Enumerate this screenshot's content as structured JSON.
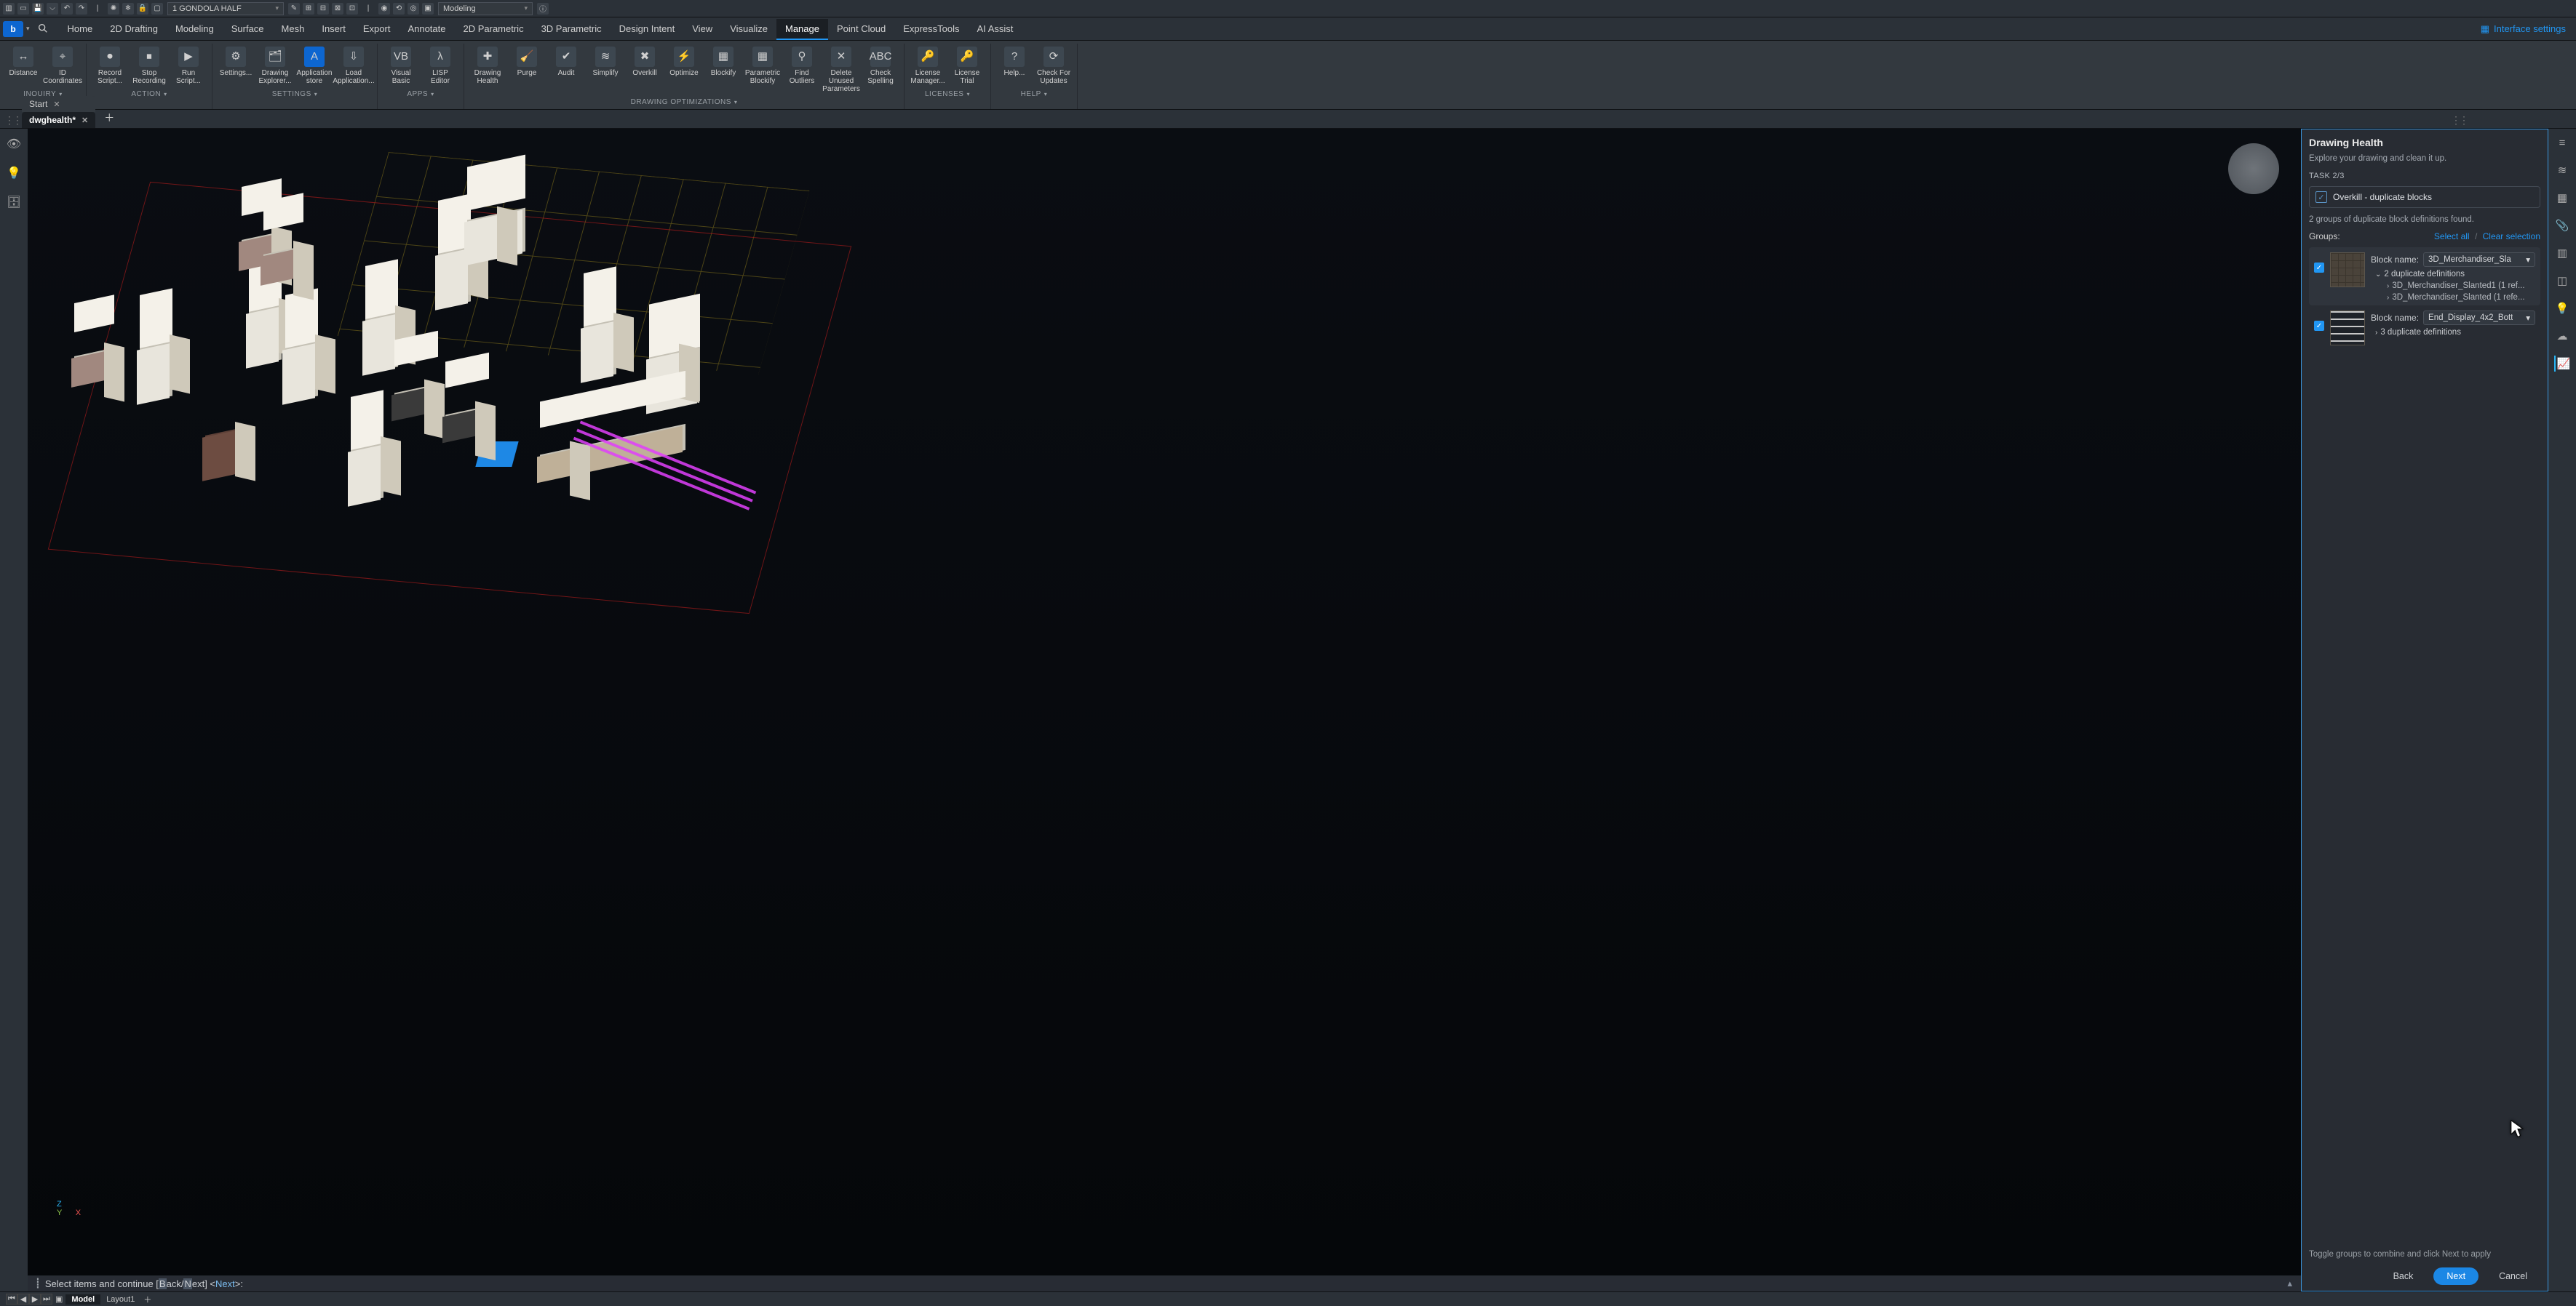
{
  "titlebar": {
    "layer_dropdown": "1 GONDOLA HALF",
    "workspace_dropdown": "Modeling"
  },
  "menubar": {
    "items": [
      "Home",
      "2D Drafting",
      "Modeling",
      "Surface",
      "Mesh",
      "Insert",
      "Export",
      "Annotate",
      "2D Parametric",
      "3D Parametric",
      "Design Intent",
      "View",
      "Visualize",
      "Manage",
      "Point Cloud",
      "ExpressTools",
      "AI Assist"
    ],
    "active": "Manage",
    "interface_link": "Interface settings"
  },
  "ribbon": {
    "panels": [
      {
        "label": "INQUIRY",
        "tools": [
          {
            "label": "Distance",
            "icon": "↔"
          },
          {
            "label": "ID Coordinates",
            "icon": "⌖"
          }
        ]
      },
      {
        "label": "ACTION",
        "tools": [
          {
            "label": "Record Script...",
            "icon": "⏺"
          },
          {
            "label": "Stop Recording",
            "icon": "⏹"
          },
          {
            "label": "Run Script...",
            "icon": "▶"
          }
        ]
      },
      {
        "label": "SETTINGS",
        "tools": [
          {
            "label": "Settings...",
            "icon": "⚙"
          },
          {
            "label": "Drawing Explorer...",
            "icon": "🗂"
          },
          {
            "label": "Application store",
            "icon": "A",
            "highlight": true
          },
          {
            "label": "Load Application...",
            "icon": "⇩"
          }
        ]
      },
      {
        "label": "APPS",
        "tools": [
          {
            "label": "Visual Basic",
            "icon": "VB"
          },
          {
            "label": "LISP Editor",
            "icon": "λ"
          }
        ]
      },
      {
        "label": "DRAWING OPTIMIZATIONS",
        "tools": [
          {
            "label": "Drawing Health",
            "icon": "✚"
          },
          {
            "label": "Purge",
            "icon": "🧹"
          },
          {
            "label": "Audit",
            "icon": "✔"
          },
          {
            "label": "Simplify",
            "icon": "≋"
          },
          {
            "label": "Overkill",
            "icon": "✖"
          },
          {
            "label": "Optimize",
            "icon": "⚡"
          },
          {
            "label": "Blockify",
            "icon": "▦"
          },
          {
            "label": "Parametric Blockify",
            "icon": "▦"
          },
          {
            "label": "Find Outliers",
            "icon": "⚲"
          },
          {
            "label": "Delete Unused Parameters",
            "icon": "✕"
          },
          {
            "label": "Check Spelling",
            "icon": "ABC"
          }
        ]
      },
      {
        "label": "LICENSES",
        "tools": [
          {
            "label": "License Manager...",
            "icon": "🔑"
          },
          {
            "label": "License Trial",
            "icon": "🔑"
          }
        ]
      },
      {
        "label": "HELP",
        "tools": [
          {
            "label": "Help...",
            "icon": "?"
          },
          {
            "label": "Check For Updates",
            "icon": "⟳"
          }
        ]
      }
    ]
  },
  "doctabs": {
    "tabs": [
      {
        "label": "Start",
        "active": false
      },
      {
        "label": "dwghealth*",
        "active": true
      }
    ]
  },
  "axis": {
    "x": "X",
    "y": "Y",
    "z": "Z"
  },
  "cmdline": {
    "text_pre": "Select items and continue [",
    "opt_b": "B",
    "opt_back": "ack",
    "sep": "/",
    "opt_n": "N",
    "opt_next": "ext",
    "text_post": "] <",
    "default": "Next",
    "text_end": ">:"
  },
  "statusbar": {
    "tabs": [
      "Model",
      "Layout1"
    ],
    "active": "Model"
  },
  "palette": {
    "title": "Drawing Health",
    "subtitle": "Explore your drawing and clean it up.",
    "task_label": "TASK 2/3",
    "task_name": "Overkill - duplicate blocks",
    "found_text": "2 groups of duplicate block definitions found.",
    "groups_label": "Groups:",
    "select_all": "Select all",
    "clear_sel": "Clear selection",
    "groups": [
      {
        "checked": true,
        "blockname_label": "Block name:",
        "blockname_value": "3D_Merchandiser_Sla",
        "dup_label": "2 duplicate definitions",
        "children": [
          "3D_Merchandiser_Slanted1 (1 ref...",
          "3D_Merchandiser_Slanted (1 refe..."
        ],
        "expanded": true,
        "selected": true,
        "thumb": "crate"
      },
      {
        "checked": true,
        "blockname_label": "Block name:",
        "blockname_value": "End_Display_4x2_Bott",
        "dup_label": "3 duplicate definitions",
        "children": [],
        "expanded": false,
        "selected": false,
        "thumb": "lines"
      }
    ],
    "hint": "Toggle groups to combine and click Next to apply",
    "back": "Back",
    "next": "Next",
    "cancel": "Cancel"
  }
}
